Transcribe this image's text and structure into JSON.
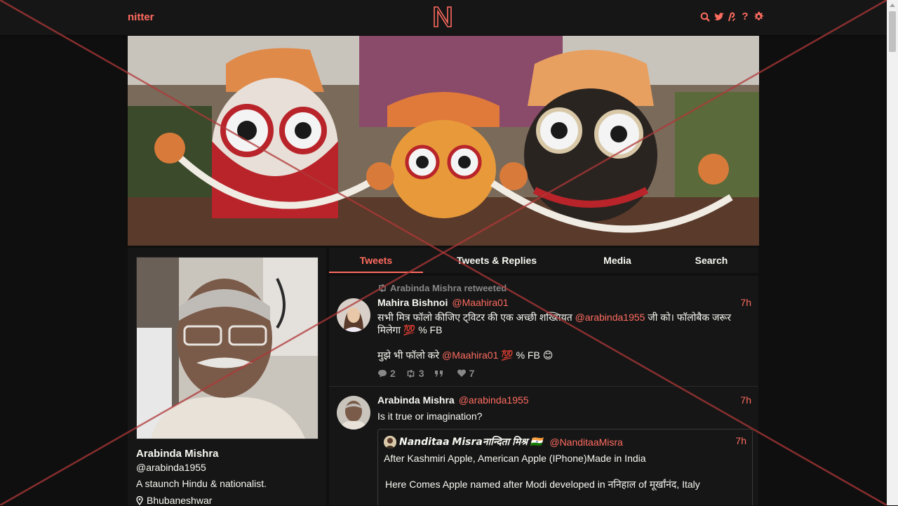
{
  "nav": {
    "brand": "nitter",
    "icons": [
      "search-icon",
      "twitter-icon",
      "rss-icon",
      "help-icon",
      "gear-icon"
    ],
    "help_glyph": "?"
  },
  "profile": {
    "name": "Arabinda Mishra",
    "handle": "@arabinda1955",
    "bio": "A staunch Hindu & nationalist.",
    "location": "Bhubaneshwar"
  },
  "tabs": [
    {
      "label": "Tweets",
      "active": true
    },
    {
      "label": "Tweets & Replies",
      "active": false
    },
    {
      "label": "Media",
      "active": false
    },
    {
      "label": "Search",
      "active": false
    }
  ],
  "tweets": [
    {
      "retweet_header": "Arabinda Mishra retweeted",
      "name": "Mahira Bishnoi",
      "handle": "@Maahira01",
      "date": "7h",
      "line1_pre": "सभी मित्र फॉलो कीजिए ट्विटर की एक अच्छी शख्सियत ",
      "line1_link": "@arabinda1955",
      "line1_post": " जी को। फॉलोबैक जरूर",
      "line2": "मिलेगा 💯 % FB",
      "line3_pre": "मुझे भी फॉलो करे ",
      "line3_link": "@Maahira01",
      "line3_post": " 💯 % FB 😊",
      "replies": "2",
      "retweets": "3",
      "quotes": "",
      "likes": "7"
    },
    {
      "name": "Arabinda Mishra",
      "handle": "@arabinda1955",
      "date": "7h",
      "text": "Is it true or imagination?",
      "quote": {
        "name": "𝙉𝙖𝙣𝙙𝙞𝙩𝙖𝙖 𝙈𝙞𝙨𝙧𝙖नान्दिता मिश्र 🇮🇳",
        "handle": "@NanditaaMisra",
        "date": "7h",
        "line1": "After Kashmiri Apple, American Apple (IPhone)Made in India",
        "line2": "Here Comes Apple named after Modi developed in ननिहाल of मूर्खांनंद, Italy"
      }
    }
  ],
  "colors": {
    "accent": "#ff6c60",
    "background": "#0f0f0f",
    "panel": "#161616",
    "text": "#f8f8f2",
    "muted": "#888889"
  }
}
